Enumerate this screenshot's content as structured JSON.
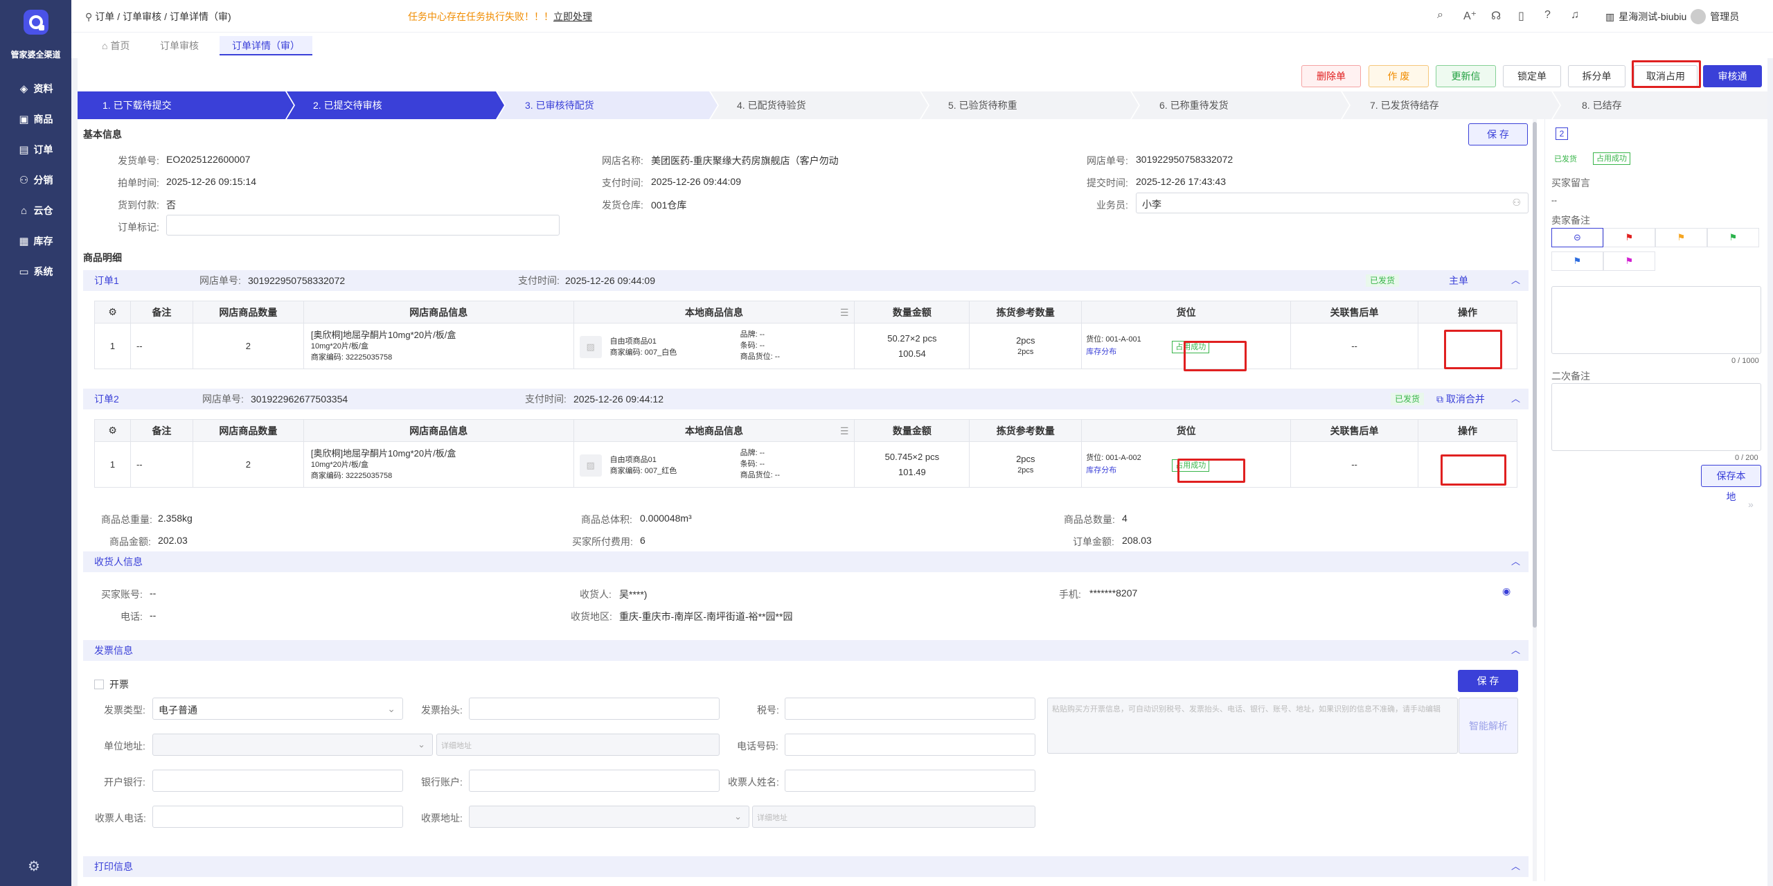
{
  "sidebar": {
    "logo_text": "管家婆全渠道",
    "items": [
      {
        "icon": "layers-icon",
        "glyph": "◈",
        "label": "资料"
      },
      {
        "icon": "box-icon",
        "glyph": "▣",
        "label": "商品"
      },
      {
        "icon": "document-icon",
        "glyph": "▤",
        "label": "订单"
      },
      {
        "icon": "share-icon",
        "glyph": "⚇",
        "label": "分销"
      },
      {
        "icon": "cloud-home-icon",
        "glyph": "⌂",
        "label": "云仓"
      },
      {
        "icon": "inventory-icon",
        "glyph": "▦",
        "label": "库存"
      },
      {
        "icon": "monitor-icon",
        "glyph": "▭",
        "label": "系统"
      }
    ],
    "settings_glyph": "⚙"
  },
  "header": {
    "breadcrumb": [
      "订单",
      "/",
      "订单审核",
      "/",
      "订单详情（审)"
    ],
    "alert": "任务中心存在任务执行失败！！！",
    "alert_link": "立即处理",
    "user_shop": "星海测试-biubiu",
    "user_role": "管理员"
  },
  "tabs": [
    {
      "label": "首页"
    },
    {
      "label": "订单审核"
    },
    {
      "label": "订单详情（审）"
    }
  ],
  "actions": {
    "delete": "删除单据",
    "void": "作 废",
    "update": "更新信息",
    "lock": "锁定单据",
    "split": "拆分单据",
    "cancel_occupy": "取消占用",
    "approve": "审核通过"
  },
  "steps": [
    "1. 已下载待提交",
    "2. 已提交待审核",
    "3. 已审核待配货",
    "4. 已配货待验货",
    "5. 已验货待称重",
    "6. 已称重待发货",
    "7. 已发货待结存",
    "8. 已结存"
  ],
  "basic": {
    "title": "基本信息",
    "save": "保 存",
    "ship_no_label": "发货单号:",
    "ship_no": "EO2025122600007",
    "shop_label": "网店名称:",
    "shop": "美团医药-重庆聚缘大药房旗舰店（客户勿动",
    "shop_order_label": "网店单号:",
    "shop_order": "301922950758332072",
    "order_time_label": "拍单时间:",
    "order_time": "2025-12-26 09:15:14",
    "pay_time_label": "支付时间:",
    "pay_time": "2025-12-26 09:44:09",
    "submit_time_label": "提交时间:",
    "submit_time": "2025-12-26 17:43:43",
    "cod_label": "货到付款:",
    "cod": "否",
    "warehouse_label": "发货仓库:",
    "warehouse": "001仓库",
    "salesman_label": "业务员:",
    "salesman": "小李",
    "mark_label": "订单标记:"
  },
  "detail_title": "商品明细",
  "columns": [
    "备注",
    "网店商品数量",
    "网店商品信息",
    "本地商品信息",
    "数量金额",
    "拣货参考数量",
    "货位",
    "关联售后单",
    "操作"
  ],
  "orders": [
    {
      "label": "订单1",
      "shop_no_label": "网店单号:",
      "shop_no": "301922950758332072",
      "pay_label": "支付时间:",
      "pay_time": "2025-12-26 09:44:09",
      "status": "已发货",
      "right_link": "主单",
      "row": {
        "idx": "1",
        "remark": "--",
        "qty": "2",
        "name": "[奥欣桐]地屈孕酮片10mg*20片/板/盒",
        "spec": "10mg*20片/板/盒",
        "merchant": "商家编码: 32225035758",
        "local_name": "自由项商品01",
        "local_code": "商家编码: 007_白色",
        "brand": "品牌: --",
        "barcode": "条码: --",
        "loc": "商品货位: --",
        "amount1": "50.27×2 pcs",
        "amount2": "100.54",
        "pick1": "2pcs",
        "pick2": "2pcs",
        "bin": "货位: 001-A-001",
        "bin_link": "库存分布",
        "occupy": "占用成功",
        "after": "--"
      }
    },
    {
      "label": "订单2",
      "shop_no_label": "网店单号:",
      "shop_no": "301922962677503354",
      "pay_label": "支付时间:",
      "pay_time": "2025-12-26 09:44:12",
      "status": "已发货",
      "right_link": "取消合并",
      "row": {
        "idx": "1",
        "remark": "--",
        "qty": "2",
        "name": "[奥欣桐]地屈孕酮片10mg*20片/板/盒",
        "spec": "10mg*20片/板/盒",
        "merchant": "商家编码: 32225035758",
        "local_name": "自由项商品01",
        "local_code": "商家编码: 007_红色",
        "brand": "品牌: --",
        "barcode": "条码: --",
        "loc": "商品货位: --",
        "amount1": "50.745×2 pcs",
        "amount2": "101.49",
        "pick1": "2pcs",
        "pick2": "2pcs",
        "bin": "货位: 001-A-002",
        "bin_link": "库存分布",
        "occupy": "占用成功",
        "after": "--"
      }
    }
  ],
  "summary": {
    "weight_label": "商品总重量:",
    "weight": "2.358kg",
    "volume_label": "商品总体积:",
    "volume": "0.000048m³",
    "count_label": "商品总数量:",
    "count": "4",
    "amount_label": "商品金额:",
    "amount": "202.03",
    "buyer_paid_label": "买家所付费用:",
    "buyer_paid": "6",
    "order_amount_label": "订单金额:",
    "order_amount": "208.03"
  },
  "receiver": {
    "title": "收货人信息",
    "account_label": "买家账号:",
    "account": "--",
    "name_label": "收货人:",
    "name": "吴****)",
    "mobile_label": "手机:",
    "mobile": "*******8207",
    "phone_label": "电话:",
    "phone": "--",
    "area_label": "收货地区:",
    "area": "重庆-重庆市-南岸区-南坪街道-裕**园**园"
  },
  "invoice": {
    "title": "发票信息",
    "open_label": "开票",
    "save": "保 存",
    "type_label": "发票类型:",
    "type": "电子普通",
    "head_label": "发票抬头:",
    "tax_label": "税号:",
    "paste_placeholder": "粘贴购买方开票信息，可自动识别税号、发票抬头、电话、银行、账号、地址，如果识别的信息不准确，请手动编辑",
    "parse": "智能解析",
    "addr_label": "单位地址:",
    "addr_detail_placeholder": "详细地址",
    "tel_label": "电话号码:",
    "bank_label": "开户银行:",
    "bank_acc_label": "银行账户:",
    "recv_name_label": "收票人姓名:",
    "recv_phone_label": "收票人电话:",
    "recv_addr_label": "收票地址:",
    "recv_addr_placeholder": "详细地址"
  },
  "print_title": "打印信息",
  "right_panel": {
    "page": "2",
    "tag1": "已发货",
    "tag2": "占用成功",
    "buyer_msg_label": "买家留言",
    "buyer_msg": "--",
    "seller_note_label": "卖家备注",
    "flag_colors": [
      "#e02020",
      "#f5a623",
      "#2bb24c",
      "#2d6cdf",
      "#d21fd2"
    ],
    "note_count": "0 / 1000",
    "second_note_label": "二次备注",
    "second_count": "0 / 200",
    "save_local": "保存本地"
  }
}
